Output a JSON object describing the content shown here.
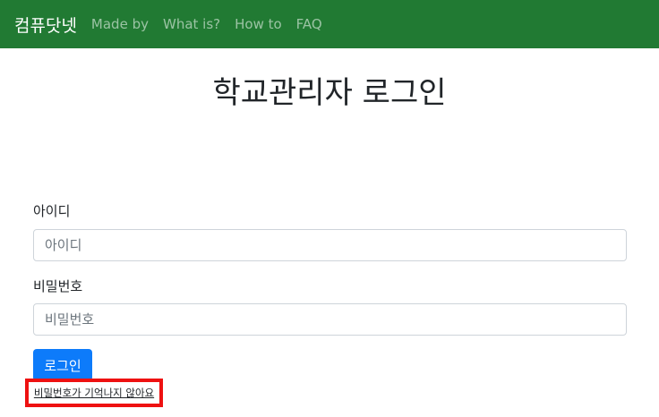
{
  "navbar": {
    "brand": "컴퓨닷넷",
    "links": [
      "Made by",
      "What is?",
      "How to",
      "FAQ"
    ],
    "background_color": "#217a33"
  },
  "main": {
    "title": "학교관리자 로그인",
    "id_label": "아이디",
    "id_placeholder": "아이디",
    "password_label": "비밀번호",
    "password_placeholder": "비밀번호",
    "login_button": "로그인",
    "forgot_password": "비밀번호가 기억나지 않아요",
    "button_color": "#0d7bfa",
    "highlight_color": "#ee1111"
  }
}
